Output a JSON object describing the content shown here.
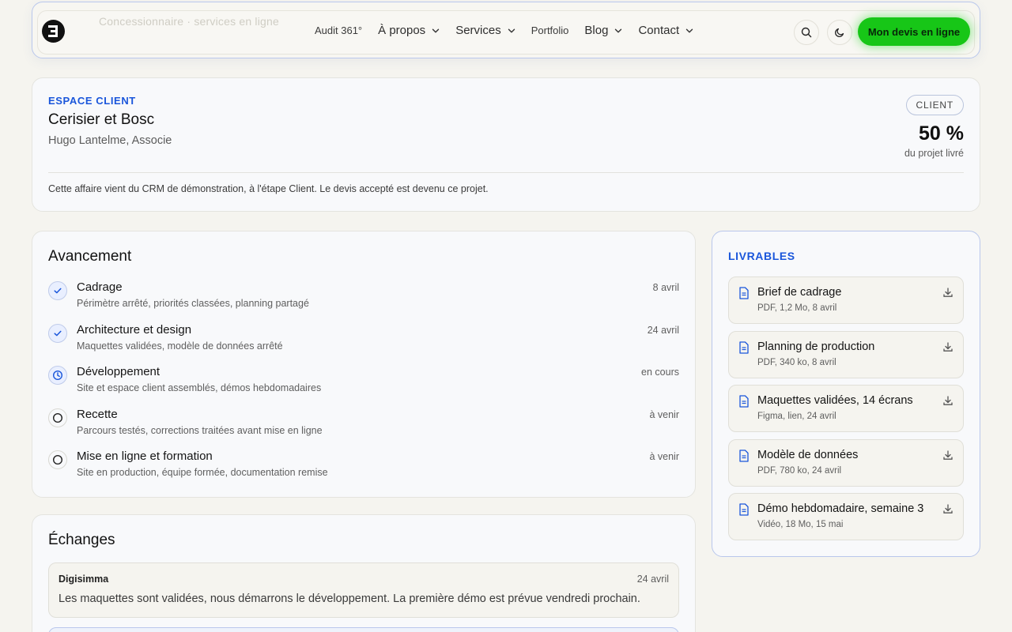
{
  "nav": {
    "ghost_text": "Concessionnaire · services en ligne",
    "items": [
      {
        "label": "Audit 361°",
        "dropdown": false
      },
      {
        "label": "À propos",
        "dropdown": true
      },
      {
        "label": "Services",
        "dropdown": true
      },
      {
        "label": "Portfolio",
        "dropdown": false
      },
      {
        "label": "Blog",
        "dropdown": true
      },
      {
        "label": "Contact",
        "dropdown": true
      }
    ],
    "cta_label": "Mon devis en ligne",
    "accent": "#17c617"
  },
  "client": {
    "eyebrow": "ESPACE CLIENT",
    "company": "Cerisier et Bosc",
    "contact": "Hugo Lantelme, Associe",
    "badge": "CLIENT",
    "progress_value": "50 %",
    "progress_caption": "du projet livré",
    "note": "Cette affaire vient du CRM de démonstration, à l'étape Client. Le devis accepté est devenu ce projet."
  },
  "progress": {
    "title": "Avancement",
    "steps": [
      {
        "title": "Cadrage",
        "desc": "Périmètre arrêté, priorités classées, planning partagé",
        "date": "8 avril",
        "status": "done"
      },
      {
        "title": "Architecture et design",
        "desc": "Maquettes validées, modèle de données arrêté",
        "date": "24 avril",
        "status": "done"
      },
      {
        "title": "Développement",
        "desc": "Site et espace client assemblés, démos hebdomadaires",
        "date": "en cours",
        "status": "in-progress"
      },
      {
        "title": "Recette",
        "desc": "Parcours testés, corrections traitées avant mise en ligne",
        "date": "à venir",
        "status": "todo"
      },
      {
        "title": "Mise en ligne et formation",
        "desc": "Site en production, équipe formée, documentation remise",
        "date": "à venir",
        "status": "todo"
      }
    ]
  },
  "deliverables": {
    "title": "LIVRABLES",
    "items": [
      {
        "name": "Brief de cadrage",
        "meta": "PDF, 1,2 Mo, 8 avril"
      },
      {
        "name": "Planning de production",
        "meta": "PDF, 340 ko, 8 avril"
      },
      {
        "name": "Maquettes validées, 14 écrans",
        "meta": "Figma, lien, 24 avril"
      },
      {
        "name": "Modèle de données",
        "meta": "PDF, 780 ko, 24 avril"
      },
      {
        "name": "Démo hebdomadaire, semaine 3",
        "meta": "Vidéo, 18 Mo, 15 mai"
      }
    ]
  },
  "exchanges": {
    "title": "Échanges",
    "messages": [
      {
        "author": "Digisimma",
        "date": "24 avril",
        "text": "Les maquettes sont validées, nous démarrons le développement. La première démo est prévue vendredi prochain."
      }
    ]
  },
  "colors": {
    "brand_blue": "#1a56db",
    "background": "#f5f4ef"
  }
}
